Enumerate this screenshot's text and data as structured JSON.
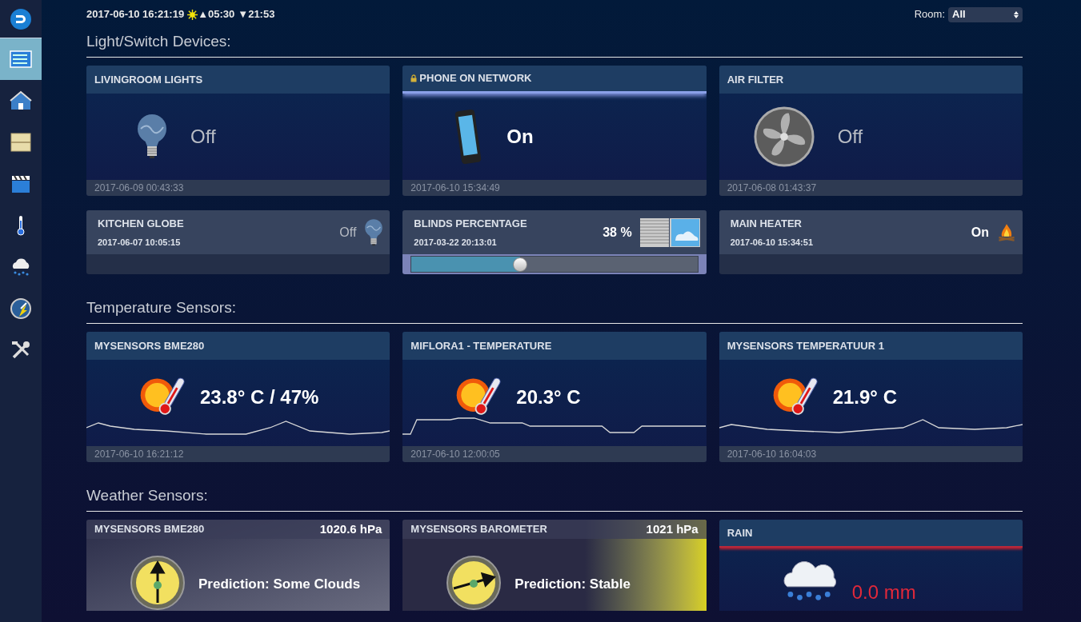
{
  "sidebar": {
    "items": [
      {
        "kind": "logo",
        "selected": false
      },
      {
        "kind": "dashboard",
        "selected": true
      },
      {
        "kind": "house",
        "selected": false
      },
      {
        "kind": "floorplan",
        "selected": false
      },
      {
        "kind": "scenes",
        "selected": false
      },
      {
        "kind": "temperature",
        "selected": false
      },
      {
        "kind": "weather",
        "selected": false
      },
      {
        "kind": "utility",
        "selected": false
      },
      {
        "kind": "setup",
        "selected": false
      }
    ]
  },
  "header": {
    "datetime": "2017-06-10 16:21:19",
    "sunrise": "▲05:30",
    "sunset": "▼21:53",
    "room_label": "Room:",
    "room_value": "All"
  },
  "sections": [
    {
      "title": "Light/Switch Devices:",
      "tiles": [
        {
          "kind": "lamp",
          "name": "LIVINGROOM LIGHTS",
          "status": "Off",
          "on": false,
          "locked": false,
          "highlight": false,
          "updated": "2017-06-09 00:43:33"
        },
        {
          "kind": "presence",
          "name": "PHONE ON NETWORK",
          "status": "On",
          "on": true,
          "locked": true,
          "highlight": true,
          "updated": "2017-06-10 15:34:49"
        },
        {
          "kind": "fan",
          "name": "AIR FILTER",
          "status": "Off",
          "on": false,
          "locked": false,
          "highlight": false,
          "updated": "2017-06-08 01:43:37"
        },
        {
          "kind": "small-lamp",
          "name": "KITCHEN GLOBE",
          "status": "Off",
          "on": false,
          "updated": "2017-06-07 10:05:15"
        },
        {
          "kind": "blinds",
          "name": "BLINDS PERCENTAGE",
          "status": "38 %",
          "on": true,
          "updated": "2017-03-22 20:13:01",
          "level": 0.38
        },
        {
          "kind": "heater",
          "name": "MAIN HEATER",
          "status": "On",
          "on": true,
          "updated": "2017-06-10 15:34:51"
        }
      ]
    },
    {
      "title": "Temperature Sensors:",
      "tiles": [
        {
          "kind": "temperature",
          "name": "MYSENSORS BME280",
          "status": "23.8° C / 47%",
          "updated": "2017-06-10 16:21:12"
        },
        {
          "kind": "temperature",
          "name": "MIFLORA1 - TEMPERATURE",
          "status": "20.3° C",
          "updated": "2017-06-10 12:00:05"
        },
        {
          "kind": "temperature",
          "name": "MYSENSORS TEMPERATUUR 1",
          "status": "21.9° C",
          "updated": "2017-06-10 16:04:03"
        }
      ]
    },
    {
      "title": "Weather Sensors:",
      "tiles": [
        {
          "kind": "barometer-clouds",
          "name": "MYSENSORS BME280",
          "reading": "1020.6 hPa",
          "status": "Prediction: Some Clouds",
          "alert": false
        },
        {
          "kind": "barometer-stable",
          "name": "MYSENSORS BAROMETER",
          "reading": "1021 hPa",
          "status": "Prediction: Stable",
          "alert": false
        },
        {
          "kind": "rain",
          "name": "RAIN",
          "status": "0.0 mm",
          "alert": true
        }
      ]
    }
  ]
}
